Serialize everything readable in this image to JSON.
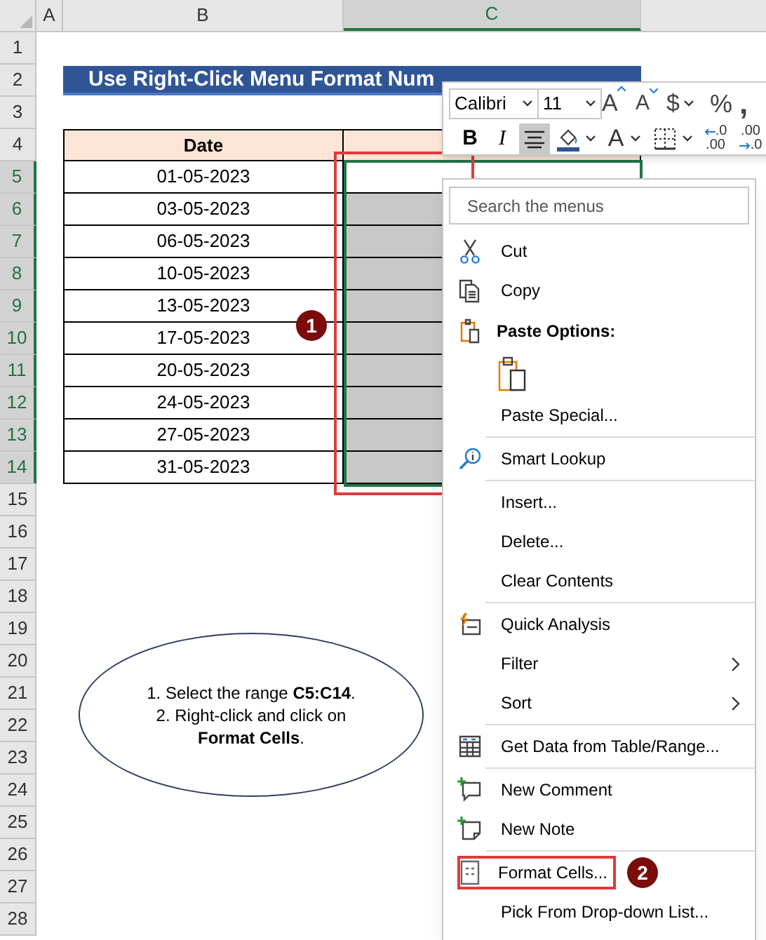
{
  "columns": [
    {
      "label": "A",
      "selected": false
    },
    {
      "label": "B",
      "selected": false
    },
    {
      "label": "C",
      "selected": true
    }
  ],
  "rows": [
    {
      "label": "1",
      "selected": false
    },
    {
      "label": "2",
      "selected": false
    },
    {
      "label": "3",
      "selected": false
    },
    {
      "label": "4",
      "selected": false
    },
    {
      "label": "5",
      "selected": true
    },
    {
      "label": "6",
      "selected": true
    },
    {
      "label": "7",
      "selected": true
    },
    {
      "label": "8",
      "selected": true
    },
    {
      "label": "9",
      "selected": true
    },
    {
      "label": "10",
      "selected": true
    },
    {
      "label": "11",
      "selected": true
    },
    {
      "label": "12",
      "selected": true
    },
    {
      "label": "13",
      "selected": true
    },
    {
      "label": "14",
      "selected": true
    },
    {
      "label": "15",
      "selected": false
    },
    {
      "label": "16",
      "selected": false
    },
    {
      "label": "17",
      "selected": false
    },
    {
      "label": "18",
      "selected": false
    },
    {
      "label": "19",
      "selected": false
    },
    {
      "label": "20",
      "selected": false
    },
    {
      "label": "21",
      "selected": false
    },
    {
      "label": "22",
      "selected": false
    },
    {
      "label": "23",
      "selected": false
    },
    {
      "label": "24",
      "selected": false
    },
    {
      "label": "25",
      "selected": false
    },
    {
      "label": "26",
      "selected": false
    },
    {
      "label": "27",
      "selected": false
    },
    {
      "label": "28",
      "selected": false
    }
  ],
  "title_banner": "Use Right-Click Menu Format Num",
  "table": {
    "header": "Date",
    "rows": [
      {
        "date": "01-05-2023",
        "shaded": false
      },
      {
        "date": "03-05-2023",
        "shaded": true
      },
      {
        "date": "06-05-2023",
        "shaded": true
      },
      {
        "date": "10-05-2023",
        "shaded": true
      },
      {
        "date": "13-05-2023",
        "shaded": true
      },
      {
        "date": "17-05-2023",
        "shaded": true
      },
      {
        "date": "20-05-2023",
        "shaded": true
      },
      {
        "date": "24-05-2023",
        "shaded": true
      },
      {
        "date": "27-05-2023",
        "shaded": true
      },
      {
        "date": "31-05-2023",
        "shaded": true
      }
    ]
  },
  "step_badges": [
    "1",
    "2"
  ],
  "note": [
    "1. Select the range **C5:C14**.",
    "2. Right-click and click on",
    "**Format Cells**."
  ],
  "mini_toolbar": {
    "font": "Calibri",
    "size": "11",
    "grow_font": "A",
    "shrink_font": "A",
    "currency": "$",
    "percent": "%",
    "comma": ",",
    "format_buttons": [
      {
        "kind": "letter",
        "label": "B",
        "selected": false
      },
      {
        "kind": "letter",
        "label": "I",
        "selected": false
      },
      {
        "kind": "align",
        "selected": true
      },
      {
        "kind": "fill",
        "selected": false
      },
      {
        "kind": "font-color",
        "label": "A",
        "selected": false
      },
      {
        "kind": "borders",
        "selected": false
      },
      {
        "kind": "decimal-more",
        "top": ".0",
        "bottom": ".00",
        "selected": false
      },
      {
        "kind": "decimal-less",
        "top": ".00",
        "bottom": ".0",
        "selected": false
      }
    ]
  },
  "context_menu": {
    "search": {
      "placeholder": "Search the menus"
    },
    "items": [
      {
        "kind": "item",
        "label": "Cut",
        "outlined": false
      },
      {
        "kind": "item",
        "label": "Copy",
        "outlined": false
      },
      {
        "kind": "heading",
        "label": "Paste Options:"
      },
      {
        "kind": "paste-icon"
      },
      {
        "kind": "item",
        "label": "Paste Special...",
        "outlined": false
      },
      {
        "kind": "separator"
      },
      {
        "kind": "item",
        "label": "Smart Lookup",
        "outlined": false
      },
      {
        "kind": "separator"
      },
      {
        "kind": "item",
        "label": "Insert...",
        "outlined": false
      },
      {
        "kind": "item",
        "label": "Delete...",
        "outlined": false
      },
      {
        "kind": "item",
        "label": "Clear Contents",
        "outlined": false
      },
      {
        "kind": "separator"
      },
      {
        "kind": "item",
        "label": "Quick Analysis",
        "outlined": false
      },
      {
        "kind": "submenu",
        "label": "Filter",
        "outlined": false
      },
      {
        "kind": "submenu",
        "label": "Sort",
        "outlined": false
      },
      {
        "kind": "separator"
      },
      {
        "kind": "item",
        "label": "Get Data from Table/Range...",
        "outlined": false
      },
      {
        "kind": "separator"
      },
      {
        "kind": "item",
        "label": "New Comment",
        "outlined": false
      },
      {
        "kind": "item",
        "label": "New Note",
        "outlined": false
      },
      {
        "kind": "separator"
      },
      {
        "kind": "item",
        "label": "Format Cells...",
        "outlined": true
      },
      {
        "kind": "item",
        "label": "Pick From Drop-down List...",
        "outlined": false
      }
    ]
  }
}
